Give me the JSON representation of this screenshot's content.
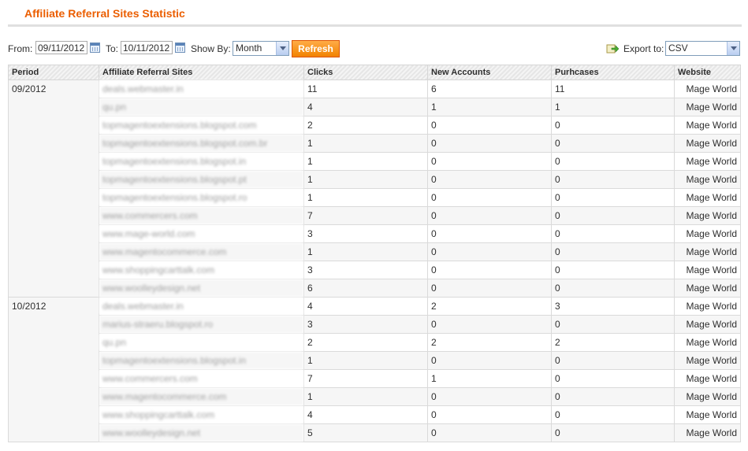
{
  "page": {
    "title": "Affiliate Referral Sites Statistic"
  },
  "filter": {
    "from_label": "From:",
    "from_value": "09/11/2012",
    "to_label": "To:",
    "to_value": "10/11/2012",
    "show_by_label": "Show By:",
    "show_by_value": "Month",
    "refresh_label": "Refresh",
    "export_label": "Export to:",
    "export_value": "CSV"
  },
  "table": {
    "headers": [
      "Period",
      "Affiliate Referral Sites",
      "Clicks",
      "New Accounts",
      "Purhcases",
      "Website"
    ],
    "groups": [
      {
        "period": "09/2012",
        "rows": [
          {
            "site": "deals.webmaster.in",
            "clicks": "11",
            "accounts": "6",
            "purchases": "11",
            "website": "Mage World"
          },
          {
            "site": "qu.pn",
            "clicks": "4",
            "accounts": "1",
            "purchases": "1",
            "website": "Mage World"
          },
          {
            "site": "topmagentoextensions.blogspot.com",
            "clicks": "2",
            "accounts": "0",
            "purchases": "0",
            "website": "Mage World"
          },
          {
            "site": "topmagentoextensions.blogspot.com.br",
            "clicks": "1",
            "accounts": "0",
            "purchases": "0",
            "website": "Mage World"
          },
          {
            "site": "topmagentoextensions.blogspot.in",
            "clicks": "1",
            "accounts": "0",
            "purchases": "0",
            "website": "Mage World"
          },
          {
            "site": "topmagentoextensions.blogspot.pt",
            "clicks": "1",
            "accounts": "0",
            "purchases": "0",
            "website": "Mage World"
          },
          {
            "site": "topmagentoextensions.blogspot.ro",
            "clicks": "1",
            "accounts": "0",
            "purchases": "0",
            "website": "Mage World"
          },
          {
            "site": "www.commercers.com",
            "clicks": "7",
            "accounts": "0",
            "purchases": "0",
            "website": "Mage World"
          },
          {
            "site": "www.mage-world.com",
            "clicks": "3",
            "accounts": "0",
            "purchases": "0",
            "website": "Mage World"
          },
          {
            "site": "www.magentocommerce.com",
            "clicks": "1",
            "accounts": "0",
            "purchases": "0",
            "website": "Mage World"
          },
          {
            "site": "www.shoppingcarttalk.com",
            "clicks": "3",
            "accounts": "0",
            "purchases": "0",
            "website": "Mage World"
          },
          {
            "site": "www.woolleydesign.net",
            "clicks": "6",
            "accounts": "0",
            "purchases": "0",
            "website": "Mage World"
          }
        ]
      },
      {
        "period": "10/2012",
        "rows": [
          {
            "site": "deals.webmaster.in",
            "clicks": "4",
            "accounts": "2",
            "purchases": "3",
            "website": "Mage World"
          },
          {
            "site": "marius-straeru.blogspot.ro",
            "clicks": "3",
            "accounts": "0",
            "purchases": "0",
            "website": "Mage World"
          },
          {
            "site": "qu.pn",
            "clicks": "2",
            "accounts": "2",
            "purchases": "2",
            "website": "Mage World"
          },
          {
            "site": "topmagentoextensions.blogspot.in",
            "clicks": "1",
            "accounts": "0",
            "purchases": "0",
            "website": "Mage World"
          },
          {
            "site": "www.commercers.com",
            "clicks": "7",
            "accounts": "1",
            "purchases": "0",
            "website": "Mage World"
          },
          {
            "site": "www.magentocommerce.com",
            "clicks": "1",
            "accounts": "0",
            "purchases": "0",
            "website": "Mage World"
          },
          {
            "site": "www.shoppingcarttalk.com",
            "clicks": "4",
            "accounts": "0",
            "purchases": "0",
            "website": "Mage World"
          },
          {
            "site": "www.woolleydesign.net",
            "clicks": "5",
            "accounts": "0",
            "purchases": "0",
            "website": "Mage World"
          }
        ]
      }
    ]
  }
}
